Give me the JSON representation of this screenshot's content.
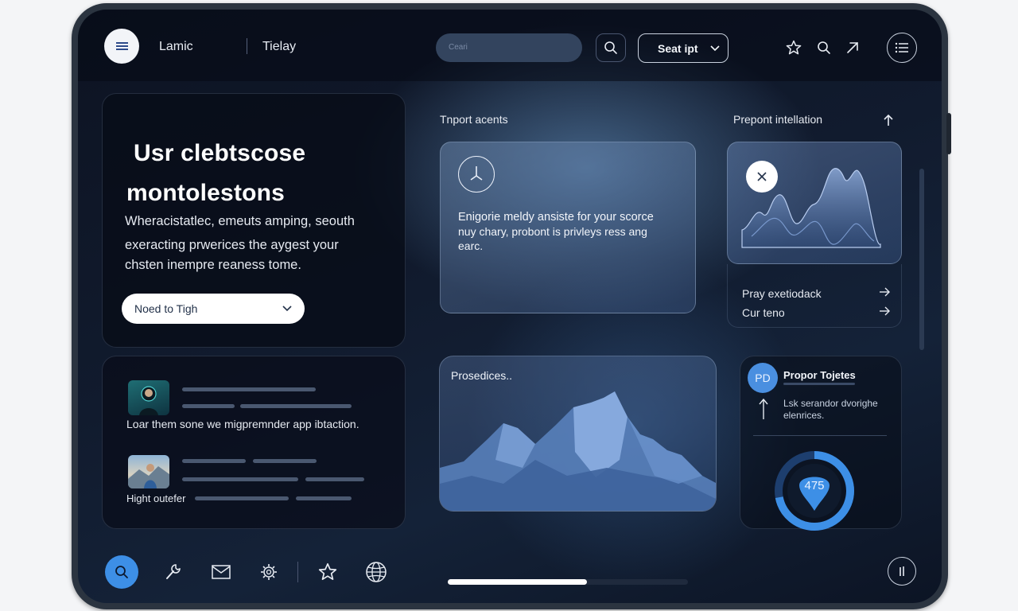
{
  "topbar": {
    "brand": "Lamic",
    "nav_title": "Tielay",
    "search_placeholder": "Ceari",
    "select_label": "Seat ipt"
  },
  "hero": {
    "title_line1": "Usr clebtscose",
    "title_line2": "montolestons",
    "body_line1": "Wheracistatlec, emeuts amping, seouth",
    "body_line2": "exeracting prwerices the aygest your",
    "body_line3": "chsten inempre reaness tome.",
    "select_value": "Noed to Tigh"
  },
  "contacts": {
    "row1_text": "Loar them sone we migpremnder app ibtaction.",
    "row2_text": "Hight outefer"
  },
  "import_section": {
    "label": "Tnport acents",
    "text_line1": "Enigorie meldy ansiste for your scorce",
    "text_line2": "nuy chary, probont is privleys ress ang",
    "text_line3": "earc."
  },
  "prepont_section": {
    "label": "Prepont intellation",
    "links": [
      {
        "label": "Pray exetiodack"
      },
      {
        "label": "Cur teno"
      }
    ]
  },
  "processes": {
    "label": "Prosedices.."
  },
  "proposal": {
    "badge": "PD",
    "title": "Propor Tojetes",
    "subtitle": "Lsk serandor dvorighe",
    "subtitle2": "elenrices.",
    "donut_value": "475",
    "donut_fraction": 0.72
  },
  "dock": {
    "progress_fraction": 0.58
  },
  "colors": {
    "accent": "#3d8fe6",
    "panel_dark": "#0b1222"
  }
}
